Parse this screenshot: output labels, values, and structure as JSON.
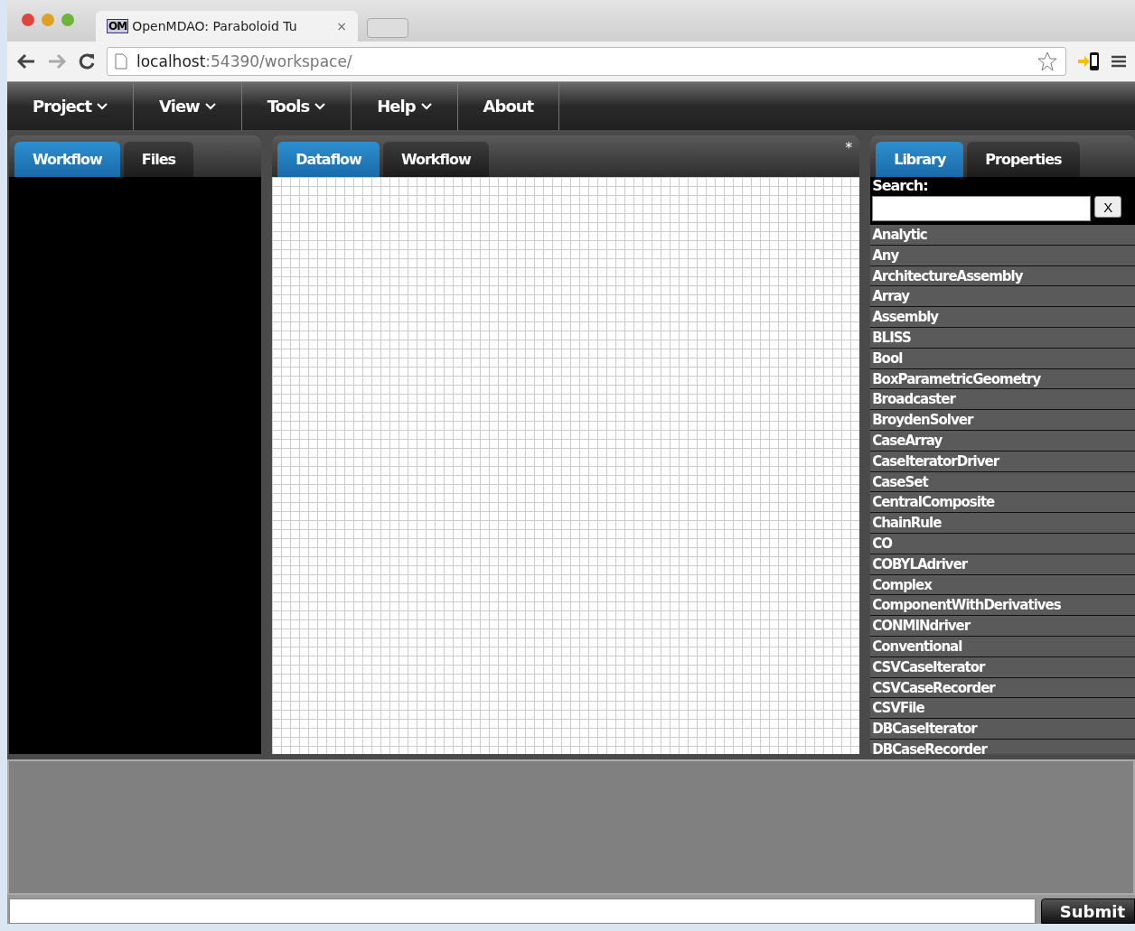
{
  "browser": {
    "tab": {
      "favicon_text": "OM",
      "title": "OpenMDAO: Paraboloid Tu",
      "close": "×"
    },
    "address": {
      "host": "localhost",
      "path": ":54390/workspace/"
    }
  },
  "menu": [
    {
      "label": "Project",
      "dropdown": true
    },
    {
      "label": "View",
      "dropdown": true
    },
    {
      "label": "Tools",
      "dropdown": true
    },
    {
      "label": "Help",
      "dropdown": true
    },
    {
      "label": "About",
      "dropdown": false
    }
  ],
  "left_panel": {
    "tabs": [
      {
        "label": "Workflow",
        "selected": true
      },
      {
        "label": "Files",
        "selected": false
      }
    ]
  },
  "center_panel": {
    "tabs": [
      {
        "label": "Dataflow",
        "selected": true
      },
      {
        "label": "Workflow",
        "selected": false
      }
    ],
    "modified_mark": "*"
  },
  "right_panel": {
    "tabs": [
      {
        "label": "Library",
        "selected": true
      },
      {
        "label": "Properties",
        "selected": false
      }
    ],
    "search_label": "Search:",
    "clear_button": "X",
    "items": [
      "Analytic",
      "Any",
      "ArchitectureAssembly",
      "Array",
      "Assembly",
      "BLISS",
      "Bool",
      "BoxParametricGeometry",
      "Broadcaster",
      "BroydenSolver",
      "CaseArray",
      "CaseIteratorDriver",
      "CaseSet",
      "CentralComposite",
      "ChainRule",
      "CO",
      "COBYLAdriver",
      "Complex",
      "ComponentWithDerivatives",
      "CONMINdriver",
      "Conventional",
      "CSVCaseIterator",
      "CSVCaseRecorder",
      "CSVFile",
      "DBCaseIterator",
      "DBCaseRecorder"
    ]
  },
  "command": {
    "submit": "Submit"
  }
}
